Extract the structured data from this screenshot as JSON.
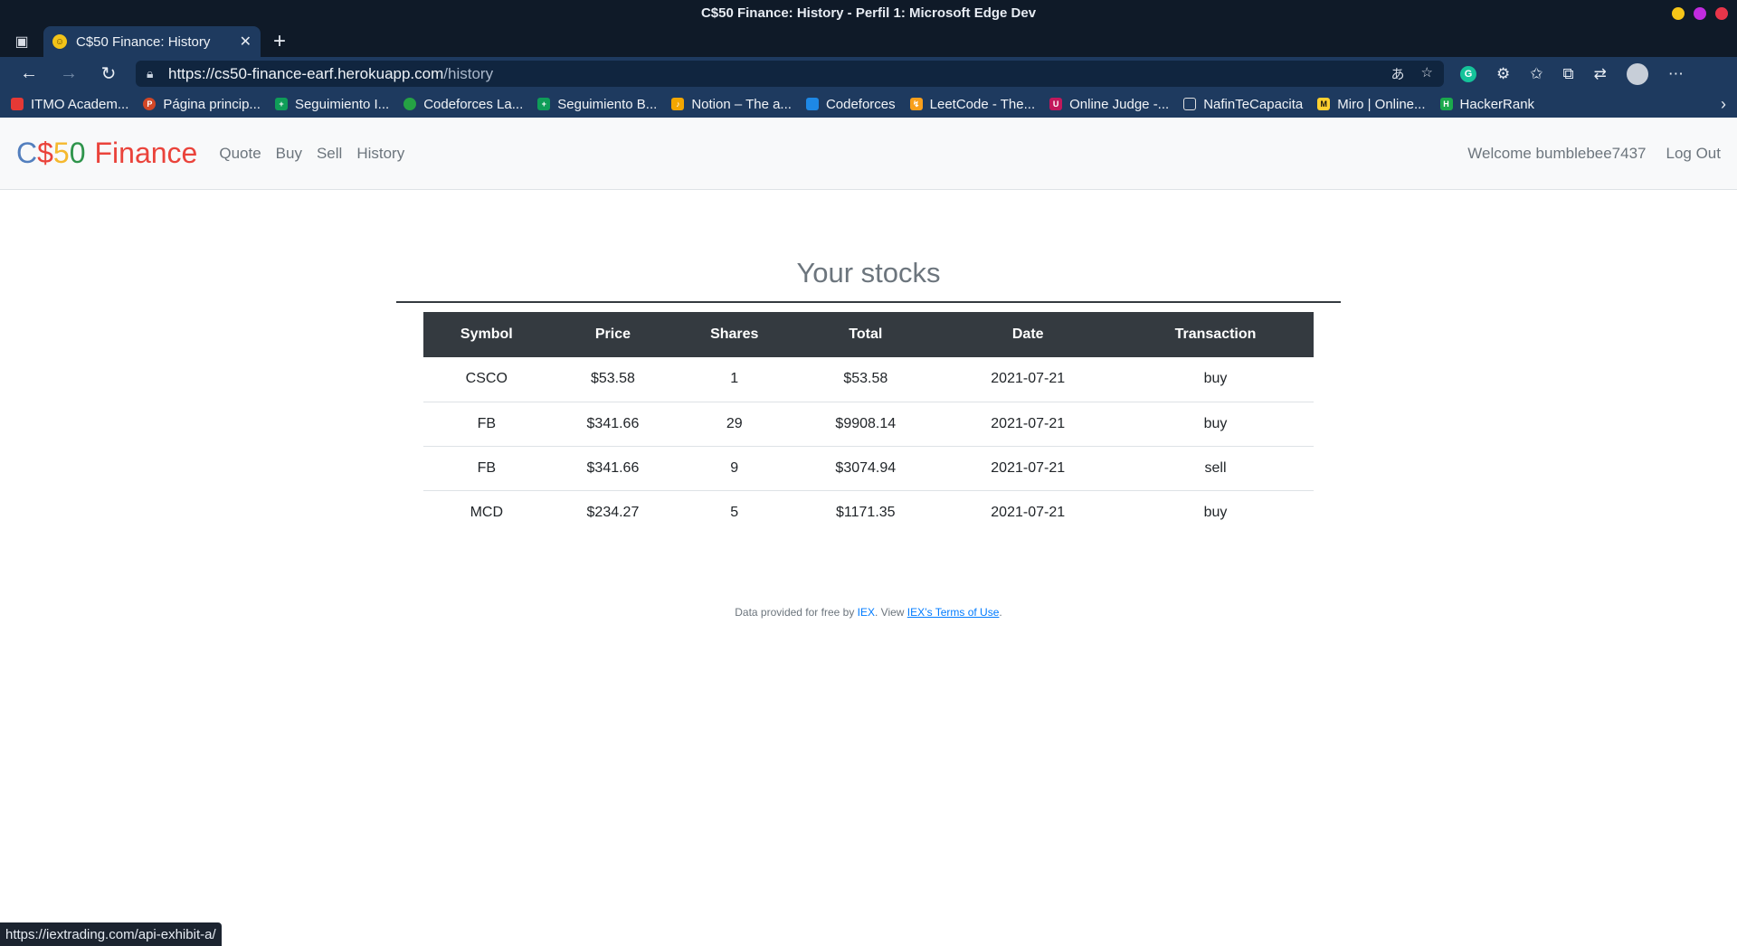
{
  "window": {
    "title": "C$50 Finance: History - Perfil 1: Microsoft Edge Dev",
    "dot_colors": [
      "#f5c518",
      "#c12be0",
      "#e8354a"
    ]
  },
  "tabs": [
    {
      "label": "C$50 Finance: History",
      "favicon": "smiley-icon",
      "close": "✕"
    }
  ],
  "browser": {
    "url_host": "https://cs50-finance-earf.herokuapp.com",
    "url_path": "/history"
  },
  "bookmarks": [
    {
      "label": "ITMO Academ...",
      "icon": "bar-chart-icon",
      "color": "#e53935"
    },
    {
      "label": "Página princip...",
      "icon": "powerpoint-icon",
      "color": "#d24726"
    },
    {
      "label": "Seguimiento I...",
      "icon": "sheets-icon",
      "color": "#0f9d58"
    },
    {
      "label": "Codeforces La...",
      "icon": "alien-icon",
      "color": "#25a244"
    },
    {
      "label": "Seguimiento B...",
      "icon": "sheets-icon",
      "color": "#0f9d58"
    },
    {
      "label": "Notion – The a...",
      "icon": "notion-icon",
      "color": "#f2a600"
    },
    {
      "label": "Codeforces",
      "icon": "bar-chart-icon",
      "color": "#1e88e5"
    },
    {
      "label": "LeetCode - The...",
      "icon": "leetcode-icon",
      "color": "#f89f1b"
    },
    {
      "label": "Online Judge -...",
      "icon": "uva-icon",
      "color": "#c2185b"
    },
    {
      "label": "NafinTeCapacita",
      "icon": "document-icon",
      "color": "#e0e0e0"
    },
    {
      "label": "Miro | Online...",
      "icon": "miro-icon",
      "color": "#ffd02f"
    },
    {
      "label": "HackerRank",
      "icon": "hackerrank-icon",
      "color": "#1ba94c"
    }
  ],
  "app": {
    "brand": {
      "p1": "C",
      "p2": "$",
      "p3": "5",
      "p4": "0",
      "p5": "Finance"
    },
    "nav": [
      "Quote",
      "Buy",
      "Sell",
      "History"
    ],
    "welcome": "Welcome bumblebee7437",
    "logout": "Log Out"
  },
  "history": {
    "heading": "Your stocks",
    "columns": [
      "Symbol",
      "Price",
      "Shares",
      "Total",
      "Date",
      "Transaction"
    ],
    "rows": [
      [
        "CSCO",
        "$53.58",
        "1",
        "$53.58",
        "2021-07-21",
        "buy"
      ],
      [
        "FB",
        "$341.66",
        "29",
        "$9908.14",
        "2021-07-21",
        "buy"
      ],
      [
        "FB",
        "$341.66",
        "9",
        "$3074.94",
        "2021-07-21",
        "sell"
      ],
      [
        "MCD",
        "$234.27",
        "5",
        "$1171.35",
        "2021-07-21",
        "buy"
      ]
    ]
  },
  "footer": {
    "text1": "Data provided for free by ",
    "link1": "IEX",
    "text2": ". View ",
    "link2": "IEX’s Terms of Use",
    "text3": "."
  },
  "status_url": "https://iextrading.com/api-exhibit-a/"
}
